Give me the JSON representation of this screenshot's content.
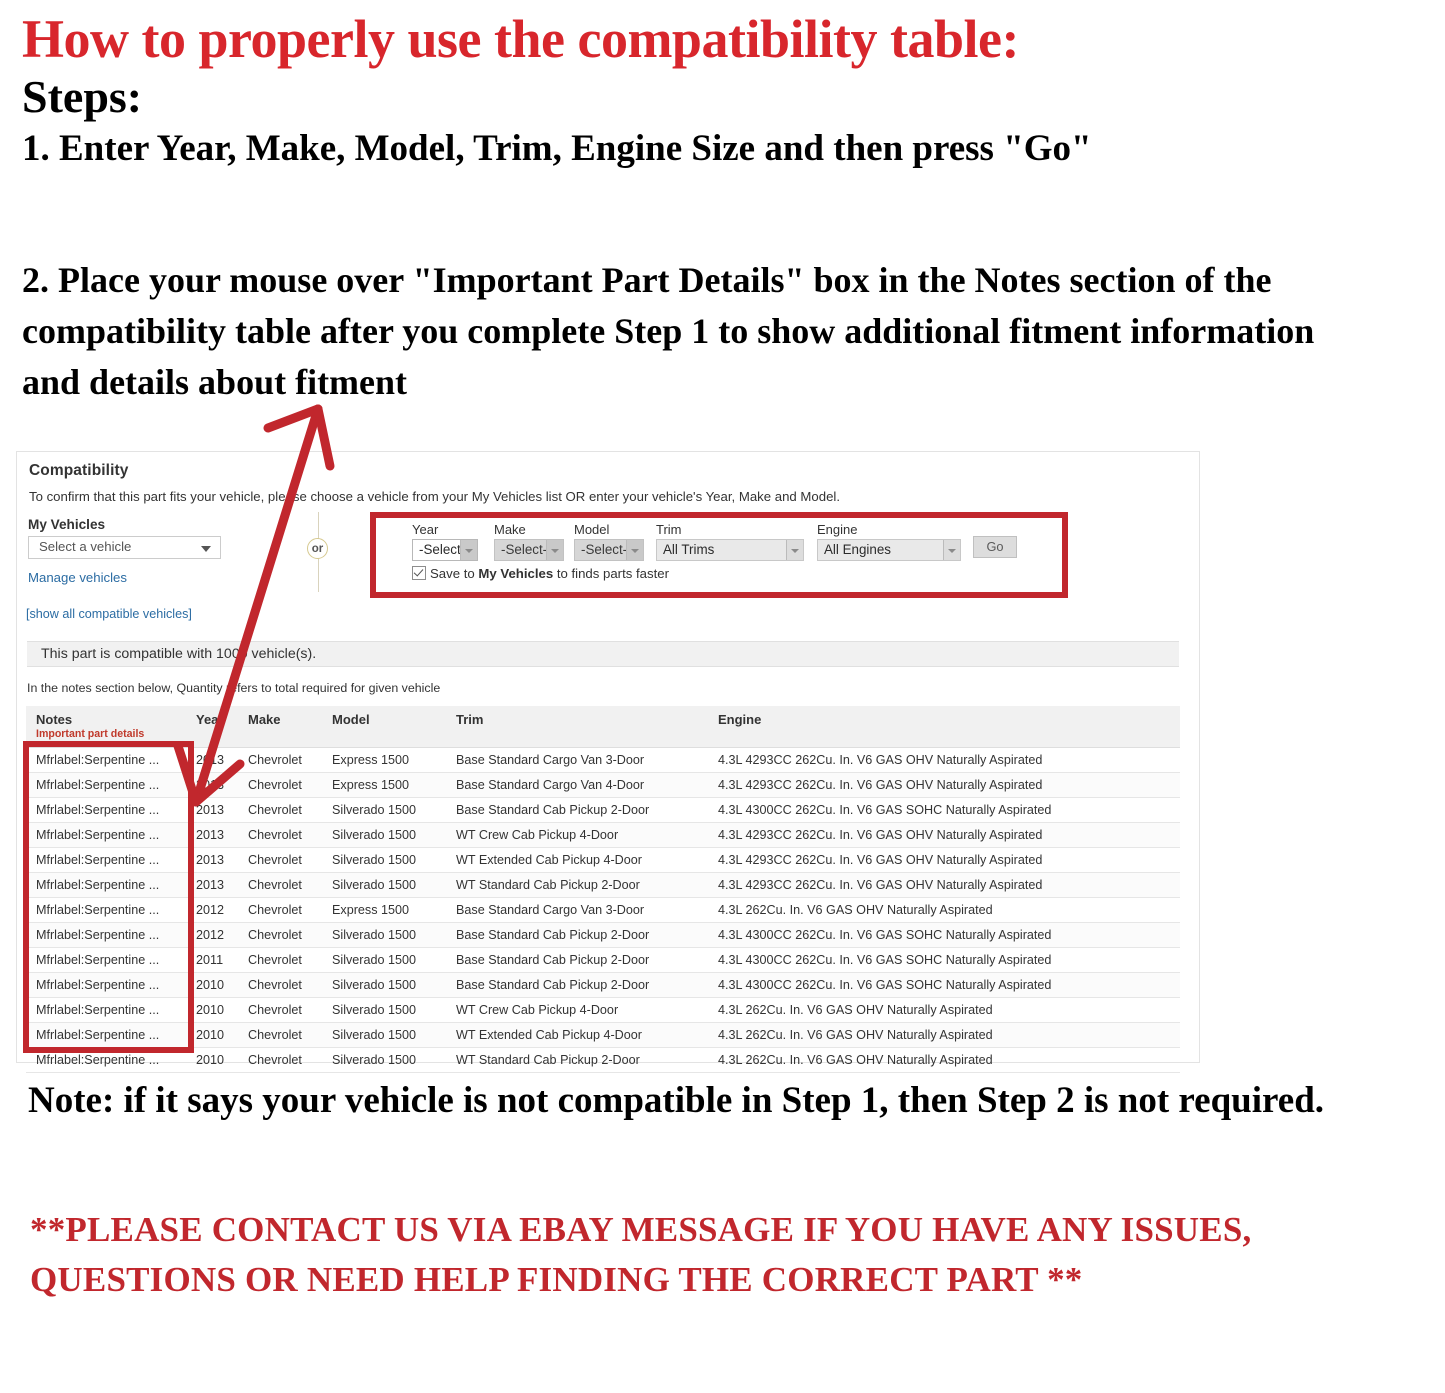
{
  "headline": {
    "title": "How to properly use the compatibility table:",
    "steps_label": "Steps:",
    "step1": "1. Enter Year, Make, Model, Trim, Engine Size and then press \"Go\"",
    "step2": "2. Place your mouse over \"Important Part Details\" box in the Notes section of the compatibility table after you complete Step 1 to show additional fitment information and details about fitment"
  },
  "colors": {
    "red_accent": "#c1272d",
    "headline_red": "#d8262c",
    "link_blue": "#2b6ca3",
    "important_red": "#c0392b"
  },
  "compatibility": {
    "title": "Compatibility",
    "subtitle": "To confirm that this part fits your vehicle, please choose a vehicle from your My Vehicles list OR enter your vehicle's Year, Make and Model.",
    "my_vehicles": {
      "label": "My Vehicles",
      "selected": "Select a vehicle",
      "manage_link": "Manage vehicles",
      "show_all_link": "[show all compatible vehicles]"
    },
    "or_divider": "or",
    "form": {
      "fields": [
        {
          "label": "Year",
          "value": "-Select-",
          "state": "enabled"
        },
        {
          "label": "Make",
          "value": "-Select-",
          "state": "disabled"
        },
        {
          "label": "Model",
          "value": "-Select-",
          "state": "disabled"
        },
        {
          "label": "Trim",
          "value": "All Trims",
          "state": "enabled"
        },
        {
          "label": "Engine",
          "value": "All Engines",
          "state": "enabled"
        }
      ],
      "go_button": "Go",
      "save_checkbox": {
        "checked": true,
        "text_before": "Save to ",
        "text_bold": "My Vehicles",
        "text_after": " to finds parts faster"
      }
    },
    "banner": "This part is compatible with 1000 vehicle(s).",
    "notes_hint": "In the notes section below, Quantity refers to total required for given vehicle",
    "table": {
      "headers": [
        "Notes",
        "Year",
        "Make",
        "Model",
        "Trim",
        "Engine"
      ],
      "notes_subheader": "Important part details",
      "rows": [
        [
          "Mfrlabel:Serpentine ...",
          "2013",
          "Chevrolet",
          "Express 1500",
          "Base Standard Cargo Van 3-Door",
          "4.3L 4293CC 262Cu. In. V6 GAS OHV Naturally Aspirated"
        ],
        [
          "Mfrlabel:Serpentine ...",
          "2013",
          "Chevrolet",
          "Express 1500",
          "Base Standard Cargo Van 4-Door",
          "4.3L 4293CC 262Cu. In. V6 GAS OHV Naturally Aspirated"
        ],
        [
          "Mfrlabel:Serpentine ...",
          "2013",
          "Chevrolet",
          "Silverado 1500",
          "Base Standard Cab Pickup 2-Door",
          "4.3L 4300CC 262Cu. In. V6 GAS SOHC Naturally Aspirated"
        ],
        [
          "Mfrlabel:Serpentine ...",
          "2013",
          "Chevrolet",
          "Silverado 1500",
          "WT Crew Cab Pickup 4-Door",
          "4.3L 4293CC 262Cu. In. V6 GAS OHV Naturally Aspirated"
        ],
        [
          "Mfrlabel:Serpentine ...",
          "2013",
          "Chevrolet",
          "Silverado 1500",
          "WT Extended Cab Pickup 4-Door",
          "4.3L 4293CC 262Cu. In. V6 GAS OHV Naturally Aspirated"
        ],
        [
          "Mfrlabel:Serpentine ...",
          "2013",
          "Chevrolet",
          "Silverado 1500",
          "WT Standard Cab Pickup 2-Door",
          "4.3L 4293CC 262Cu. In. V6 GAS OHV Naturally Aspirated"
        ],
        [
          "Mfrlabel:Serpentine ...",
          "2012",
          "Chevrolet",
          "Express 1500",
          "Base Standard Cargo Van 3-Door",
          "4.3L 262Cu. In. V6 GAS OHV Naturally Aspirated"
        ],
        [
          "Mfrlabel:Serpentine ...",
          "2012",
          "Chevrolet",
          "Silverado 1500",
          "Base Standard Cab Pickup 2-Door",
          "4.3L 4300CC 262Cu. In. V6 GAS SOHC Naturally Aspirated"
        ],
        [
          "Mfrlabel:Serpentine ...",
          "2011",
          "Chevrolet",
          "Silverado 1500",
          "Base Standard Cab Pickup 2-Door",
          "4.3L 4300CC 262Cu. In. V6 GAS SOHC Naturally Aspirated"
        ],
        [
          "Mfrlabel:Serpentine ...",
          "2010",
          "Chevrolet",
          "Silverado 1500",
          "Base Standard Cab Pickup 2-Door",
          "4.3L 4300CC 262Cu. In. V6 GAS SOHC Naturally Aspirated"
        ],
        [
          "Mfrlabel:Serpentine ...",
          "2010",
          "Chevrolet",
          "Silverado 1500",
          "WT Crew Cab Pickup 4-Door",
          "4.3L 262Cu. In. V6 GAS OHV Naturally Aspirated"
        ],
        [
          "Mfrlabel:Serpentine ...",
          "2010",
          "Chevrolet",
          "Silverado 1500",
          "WT Extended Cab Pickup 4-Door",
          "4.3L 262Cu. In. V6 GAS OHV Naturally Aspirated"
        ],
        [
          "Mfrlabel:Serpentine ...",
          "2010",
          "Chevrolet",
          "Silverado 1500",
          "WT Standard Cab Pickup 2-Door",
          "4.3L 262Cu. In. V6 GAS OHV Naturally Aspirated"
        ]
      ]
    }
  },
  "footer": {
    "note": "Note: if it says your vehicle is not compatible in Step 1, then Step 2 is not required.",
    "contact": "**PLEASE CONTACT US VIA EBAY MESSAGE IF YOU HAVE ANY ISSUES, QUESTIONS OR NEED HELP FINDING THE CORRECT PART **"
  }
}
